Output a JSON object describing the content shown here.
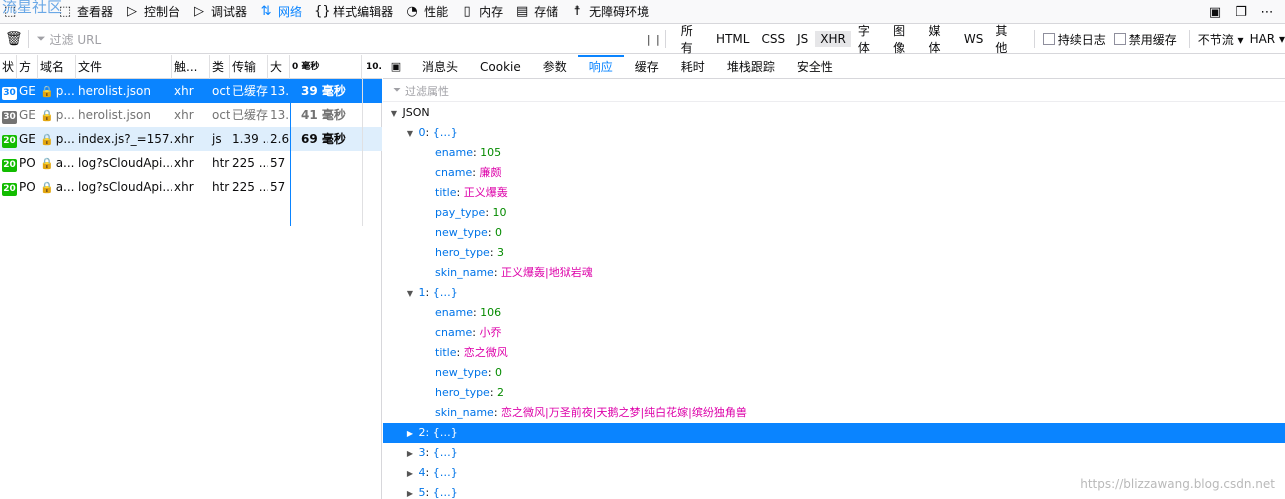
{
  "brand": "流星社区",
  "toolbar": {
    "tabs": [
      {
        "id": "inspector",
        "label": "查看器",
        "icon": "inspector-icon",
        "glyph": "⬚"
      },
      {
        "id": "console",
        "label": "控制台",
        "icon": "console-icon",
        "glyph": "▷"
      },
      {
        "id": "debugger",
        "label": "调试器",
        "icon": "debugger-icon",
        "glyph": "▷"
      },
      {
        "id": "network",
        "label": "网络",
        "icon": "network-icon",
        "glyph": "⇅"
      },
      {
        "id": "style",
        "label": "样式编辑器",
        "icon": "style-editor-icon",
        "glyph": "{}"
      },
      {
        "id": "performance",
        "label": "性能",
        "icon": "performance-icon",
        "glyph": "◔"
      },
      {
        "id": "memory",
        "label": "内存",
        "icon": "memory-icon",
        "glyph": "▯"
      },
      {
        "id": "storage",
        "label": "存储",
        "icon": "storage-icon",
        "glyph": "▤"
      },
      {
        "id": "a11y",
        "label": "无障碍环境",
        "icon": "accessibility-icon",
        "glyph": "☨"
      }
    ],
    "active": "network"
  },
  "filter": {
    "url_placeholder": "过滤 URL",
    "types": [
      "所有",
      "HTML",
      "CSS",
      "JS",
      "XHR",
      "字体",
      "图像",
      "媒体",
      "WS",
      "其他"
    ],
    "active_type": "XHR",
    "persist_logs": "持续日志",
    "disable_cache": "禁用缓存",
    "throttle": "不节流 ▾",
    "har": "HAR ▾"
  },
  "columns": {
    "status": "状",
    "method": "方",
    "domain": "域名",
    "file": "文件",
    "cause": "触...",
    "type": "类",
    "transferred": "传输",
    "size": "大",
    "timeline_start": "0 毫秒",
    "timeline_end": "10."
  },
  "requests": [
    {
      "status": "30",
      "method": "GE",
      "domain": "p...",
      "file": "herolist.json",
      "cause": "xhr",
      "type": "oct",
      "transferred": "已缓存",
      "size": "13.",
      "timing": "39 毫秒",
      "state": "selected"
    },
    {
      "status": "30",
      "method": "GE",
      "domain": "p...",
      "file": "herolist.json",
      "cause": "xhr",
      "type": "oct",
      "transferred": "已缓存",
      "size": "13.",
      "timing": "41 毫秒",
      "state": "dim"
    },
    {
      "status": "20",
      "method": "GE",
      "domain": "p...",
      "file": "index.js?_=157...",
      "cause": "xhr",
      "type": "js",
      "transferred": "1.39 ...",
      "size": "2.6",
      "timing": "69 毫秒",
      "state": "highlight"
    },
    {
      "status": "20",
      "method": "PO",
      "domain": "a...",
      "file": "log?sCloudApi...",
      "cause": "xhr",
      "type": "htr",
      "transferred": "225 ...",
      "size": "57",
      "timing": "",
      "state": "normal"
    },
    {
      "status": "20",
      "method": "PO",
      "domain": "a...",
      "file": "log?sCloudApi...",
      "cause": "xhr",
      "type": "htr",
      "transferred": "225 ...",
      "size": "57",
      "timing": "",
      "state": "normal"
    }
  ],
  "details": {
    "tabs": [
      "消息头",
      "Cookie",
      "参数",
      "响应",
      "缓存",
      "耗时",
      "堆栈跟踪",
      "安全性"
    ],
    "active_tab": "响应",
    "filter_placeholder": "过滤属性",
    "tree": [
      {
        "depth": 0,
        "twisty": "open",
        "key": "JSON",
        "value": "",
        "kind": "label"
      },
      {
        "depth": 1,
        "twisty": "open",
        "key": "0",
        "value": "{…}",
        "kind": "obj"
      },
      {
        "depth": 2,
        "twisty": "",
        "key": "ename",
        "value": "105",
        "kind": "num"
      },
      {
        "depth": 2,
        "twisty": "",
        "key": "cname",
        "value": "廉颇",
        "kind": "str"
      },
      {
        "depth": 2,
        "twisty": "",
        "key": "title",
        "value": "正义爆轰",
        "kind": "str"
      },
      {
        "depth": 2,
        "twisty": "",
        "key": "pay_type",
        "value": "10",
        "kind": "num"
      },
      {
        "depth": 2,
        "twisty": "",
        "key": "new_type",
        "value": "0",
        "kind": "num"
      },
      {
        "depth": 2,
        "twisty": "",
        "key": "hero_type",
        "value": "3",
        "kind": "num"
      },
      {
        "depth": 2,
        "twisty": "",
        "key": "skin_name",
        "value": "正义爆轰|地狱岩魂",
        "kind": "str"
      },
      {
        "depth": 1,
        "twisty": "open",
        "key": "1",
        "value": "{…}",
        "kind": "obj"
      },
      {
        "depth": 2,
        "twisty": "",
        "key": "ename",
        "value": "106",
        "kind": "num"
      },
      {
        "depth": 2,
        "twisty": "",
        "key": "cname",
        "value": "小乔",
        "kind": "str"
      },
      {
        "depth": 2,
        "twisty": "",
        "key": "title",
        "value": "恋之微风",
        "kind": "str"
      },
      {
        "depth": 2,
        "twisty": "",
        "key": "new_type",
        "value": "0",
        "kind": "num"
      },
      {
        "depth": 2,
        "twisty": "",
        "key": "hero_type",
        "value": "2",
        "kind": "num"
      },
      {
        "depth": 2,
        "twisty": "",
        "key": "skin_name",
        "value": "恋之微风|万圣前夜|天鹅之梦|纯白花嫁|缤纷独角兽",
        "kind": "str"
      },
      {
        "depth": 1,
        "twisty": "closed",
        "key": "2",
        "value": "{…}",
        "kind": "obj",
        "selected": true
      },
      {
        "depth": 1,
        "twisty": "closed",
        "key": "3",
        "value": "{…}",
        "kind": "obj"
      },
      {
        "depth": 1,
        "twisty": "closed",
        "key": "4",
        "value": "{…}",
        "kind": "obj"
      },
      {
        "depth": 1,
        "twisty": "closed",
        "key": "5",
        "value": "{…}",
        "kind": "obj"
      }
    ]
  },
  "watermark": "https://blizzawang.blog.csdn.net"
}
